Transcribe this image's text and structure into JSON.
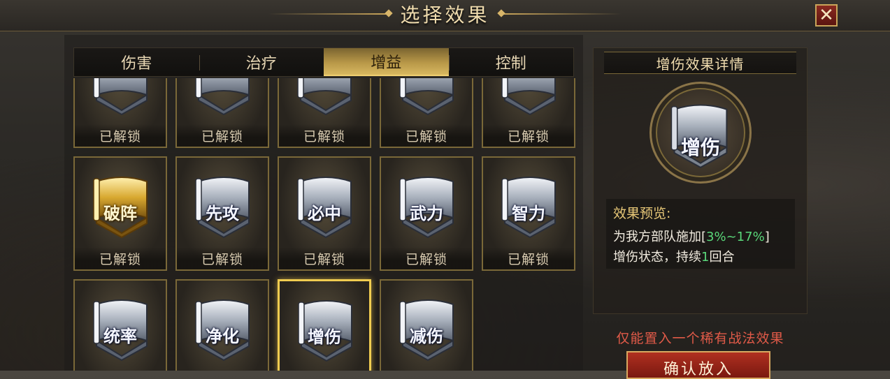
{
  "header": {
    "title": "选择效果",
    "close_glyph": "✕"
  },
  "tabs": [
    {
      "label": "伤害",
      "active": false
    },
    {
      "label": "治疗",
      "active": false
    },
    {
      "label": "增益",
      "active": true
    },
    {
      "label": "控制",
      "active": false
    }
  ],
  "status_text": "已解锁",
  "cards": [
    {
      "label": "",
      "status": "已解锁",
      "style": "silver",
      "selected": false
    },
    {
      "label": "",
      "status": "已解锁",
      "style": "silver",
      "selected": false
    },
    {
      "label": "",
      "status": "已解锁",
      "style": "silver",
      "selected": false
    },
    {
      "label": "",
      "status": "已解锁",
      "style": "silver",
      "selected": false
    },
    {
      "label": "",
      "status": "已解锁",
      "style": "silver",
      "selected": false
    },
    {
      "label": "破阵",
      "status": "已解锁",
      "style": "gold",
      "selected": false
    },
    {
      "label": "先攻",
      "status": "已解锁",
      "style": "silver",
      "selected": false
    },
    {
      "label": "必中",
      "status": "已解锁",
      "style": "silver",
      "selected": false
    },
    {
      "label": "武力",
      "status": "已解锁",
      "style": "silver",
      "selected": false
    },
    {
      "label": "智力",
      "status": "已解锁",
      "style": "silver",
      "selected": false
    },
    {
      "label": "统率",
      "status": "已解锁",
      "style": "silver",
      "selected": false
    },
    {
      "label": "净化",
      "status": "已解锁",
      "style": "silver",
      "selected": false
    },
    {
      "label": "增伤",
      "status": "已解锁",
      "style": "silver",
      "selected": true
    },
    {
      "label": "减伤",
      "status": "已解锁",
      "style": "silver",
      "selected": false
    }
  ],
  "detail": {
    "title": "增伤效果详情",
    "icon_label": "增伤",
    "preview_heading": "效果预览:",
    "preview_line1_a": "为我方部队施加[",
    "preview_line1_range": "3%~17%",
    "preview_line1_b": "]",
    "preview_line2_a": "增伤状态，持续",
    "preview_line2_num": "1",
    "preview_line2_b": "回合"
  },
  "rare_note": "仅能置入一个稀有战法效果",
  "confirm_label": "确认放入",
  "colors": {
    "gold_accent": "#c9a55a",
    "highlight_green": "#5ad87a",
    "warning_red": "#e05a48"
  }
}
